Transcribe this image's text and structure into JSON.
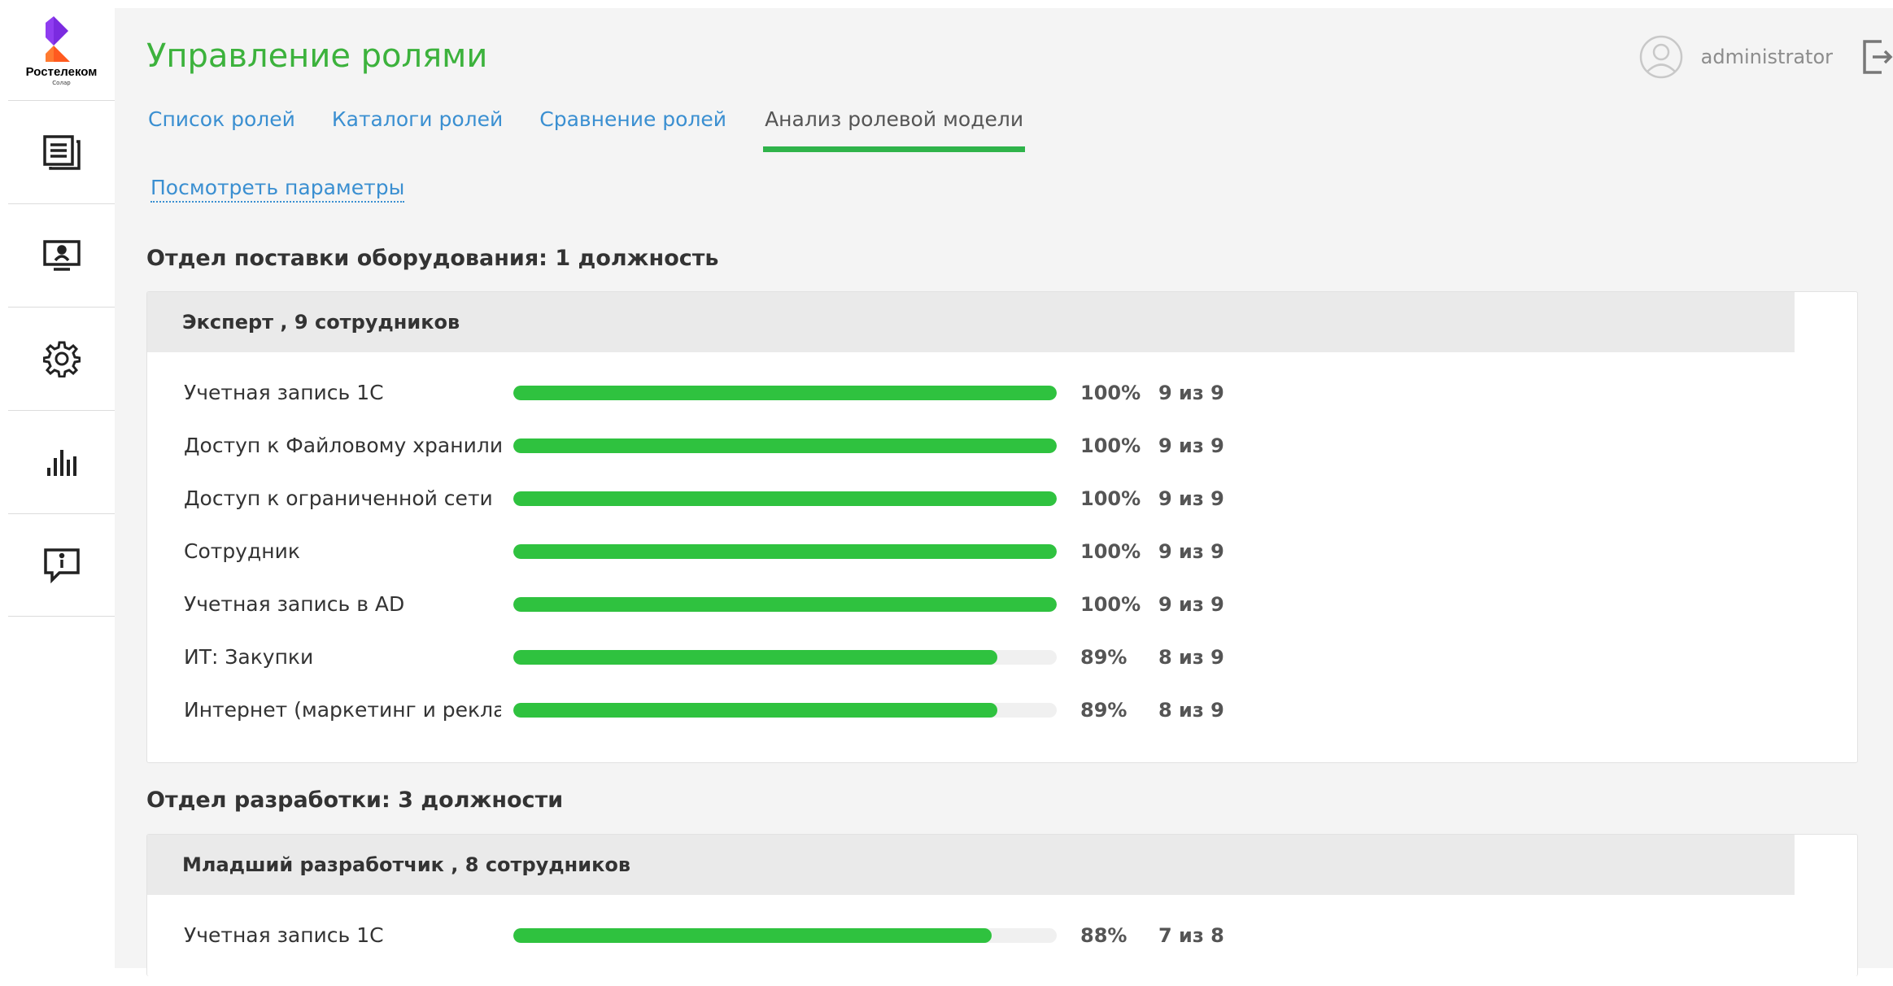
{
  "brand": {
    "name": "Ростелеком",
    "subtitle": "Солар"
  },
  "sidebar": {
    "items": [
      {
        "icon": "document-list-icon"
      },
      {
        "icon": "monitor-user-icon"
      },
      {
        "icon": "gear-icon"
      },
      {
        "icon": "bar-chart-icon"
      },
      {
        "icon": "info-message-icon"
      }
    ]
  },
  "header": {
    "title": "Управление ролями",
    "user_name": "administrator"
  },
  "tabs": [
    {
      "label": "Список ролей",
      "active": false
    },
    {
      "label": "Каталоги ролей",
      "active": false
    },
    {
      "label": "Сравнение ролей",
      "active": false
    },
    {
      "label": "Анализ ролевой модели",
      "active": true
    }
  ],
  "params_link": "Посмотреть параметры",
  "colors": {
    "accent": "#3cb23c",
    "bar": "#2fc23f",
    "link": "#3a8fd1"
  },
  "sections": [
    {
      "title": "Отдел поставки оборудования: 1 должность",
      "positions": [
        {
          "header": "Эксперт , 9 сотрудников",
          "rows": [
            {
              "label": "Учетная запись 1С",
              "percent_value": 100,
              "percent": "100%",
              "count": "9 из 9"
            },
            {
              "label": "Доступ к Файловому хранили...",
              "percent_value": 100,
              "percent": "100%",
              "count": "9 из 9"
            },
            {
              "label": "Доступ к ограниченной сети ...",
              "percent_value": 100,
              "percent": "100%",
              "count": "9 из 9"
            },
            {
              "label": "Сотрудник",
              "percent_value": 100,
              "percent": "100%",
              "count": "9 из 9"
            },
            {
              "label": "Учетная запись в AD",
              "percent_value": 100,
              "percent": "100%",
              "count": "9 из 9"
            },
            {
              "label": "ИТ: Закупки",
              "percent_value": 89,
              "percent": "89%",
              "count": "8 из 9"
            },
            {
              "label": "Интернет (маркетинг и рекла...",
              "percent_value": 89,
              "percent": "89%",
              "count": "8 из 9"
            }
          ]
        }
      ]
    },
    {
      "title": "Отдел разработки: 3 должности",
      "positions": [
        {
          "header": "Младший разработчик , 8 сотрудников",
          "rows": [
            {
              "label": "Учетная запись 1С",
              "percent_value": 88,
              "percent": "88%",
              "count": "7 из 8"
            }
          ]
        }
      ]
    }
  ]
}
